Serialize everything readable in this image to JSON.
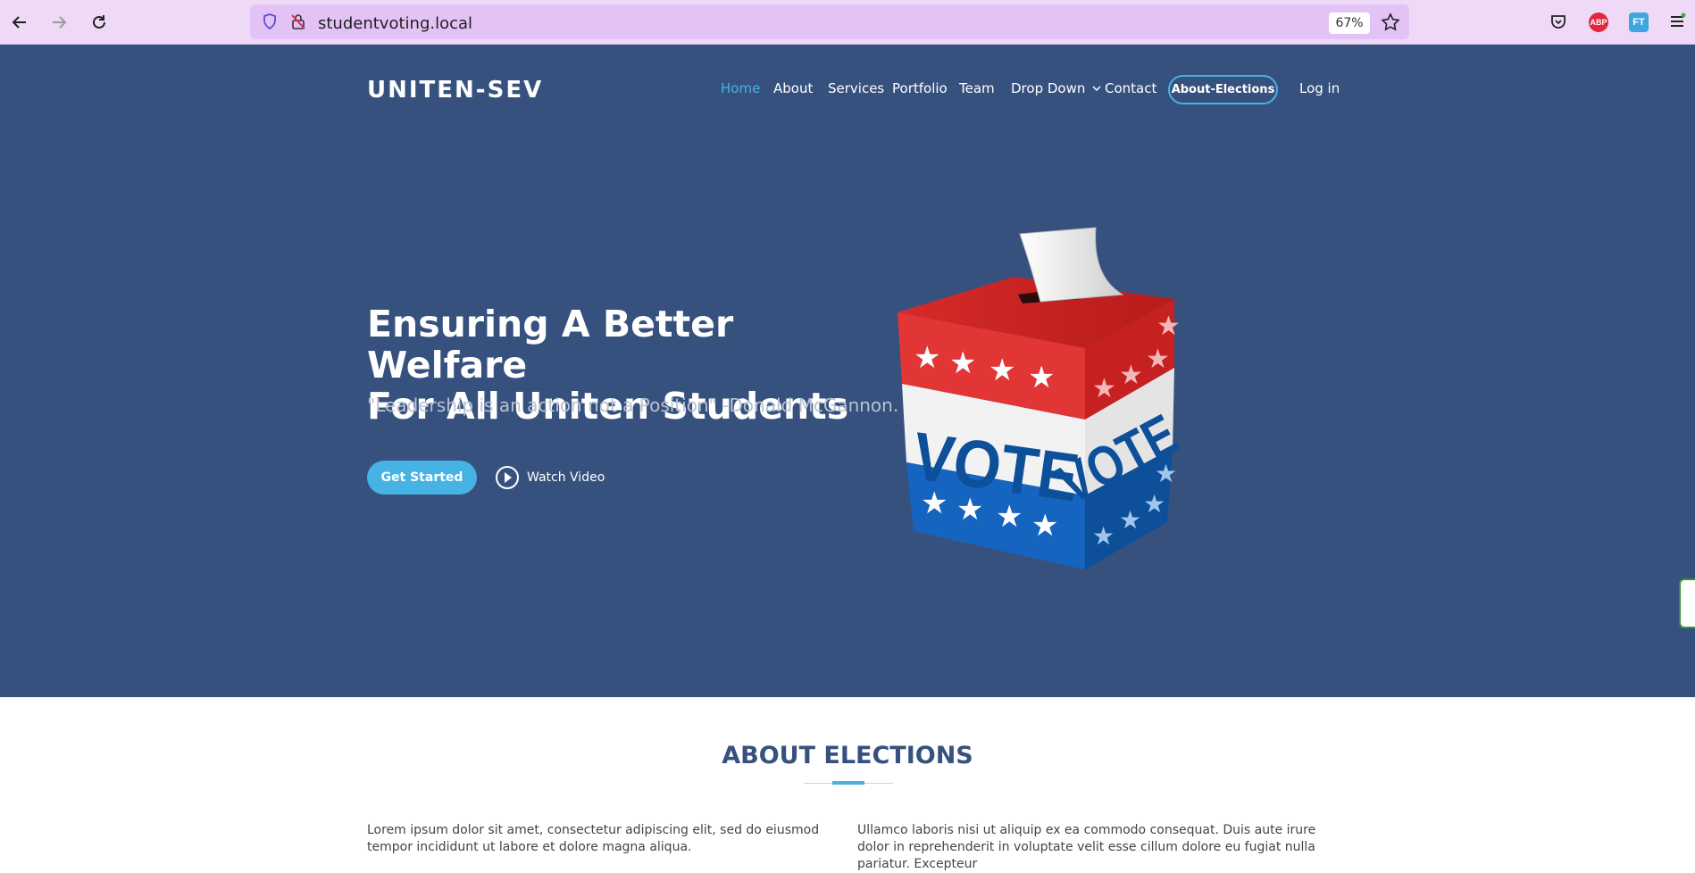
{
  "browser": {
    "url": "studentvoting.local",
    "zoom": "67%",
    "back_icon": "arrow-left-icon",
    "forward_icon": "arrow-right-icon",
    "reload_icon": "reload-icon",
    "extensions": [
      "pocket-icon",
      "adblock-plus-icon",
      "translate-icon",
      "menu-icon"
    ],
    "abp_label": "ABP",
    "translate_label": "FT"
  },
  "site": {
    "logo": "UNITEN-SEV",
    "nav": [
      {
        "label": "Home",
        "active": true
      },
      {
        "label": "About",
        "active": false
      },
      {
        "label": "Services",
        "active": false
      },
      {
        "label": "Portfolio",
        "active": false
      },
      {
        "label": "Team",
        "active": false
      },
      {
        "label": "Drop Down",
        "active": false
      },
      {
        "label": "Contact",
        "active": false
      }
    ],
    "elections_button": "About-Elections",
    "login": "Log in",
    "hero": {
      "title_line1": "Ensuring A Better Welfare",
      "title_line2": "For All Uniten Students",
      "subtitle": "\"Leadership is an action not a Position\" -Donald McGannon.",
      "cta": "Get Started",
      "watch": "Watch Video",
      "image_word": "VOTE"
    },
    "about": {
      "title": "ABOUT ELECTIONS",
      "left_text": "Lorem ipsum dolor sit amet, consectetur adipiscing elit, sed do eiusmod tempor incididunt ut labore et dolore magna aliqua.",
      "right_text": "Ullamco laboris nisi ut aliquip ex ea commodo consequat. Duis aute irure dolor in reprehenderit in voluptate velit esse cillum dolore eu fugiat nulla pariatur. Excepteur"
    }
  },
  "colors": {
    "hero_bg": "#37517e",
    "accent": "#47b2e4",
    "chrome_bg": "#eed9f7",
    "urlbar_bg": "#e3c3f5"
  }
}
